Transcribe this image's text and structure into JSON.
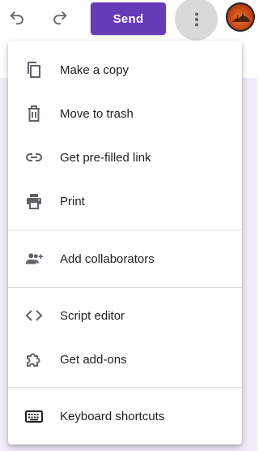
{
  "toolbar": {
    "undo_icon": "undo-icon",
    "redo_icon": "redo-icon",
    "send_label": "Send",
    "more_icon": "more-vert-icon",
    "send_color": "#673ab7"
  },
  "menu": {
    "items": [
      {
        "label": "Make a copy",
        "icon": "copy-icon"
      },
      {
        "label": "Move to trash",
        "icon": "trash-icon"
      },
      {
        "label": "Get pre-filled link",
        "icon": "link-icon"
      },
      {
        "label": "Print",
        "icon": "print-icon"
      },
      {
        "label": "Add collaborators",
        "icon": "add-people-icon"
      },
      {
        "label": "Script editor",
        "icon": "code-icon"
      },
      {
        "label": "Get add-ons",
        "icon": "puzzle-icon"
      },
      {
        "label": "Keyboard shortcuts",
        "icon": "keyboard-icon"
      }
    ]
  }
}
